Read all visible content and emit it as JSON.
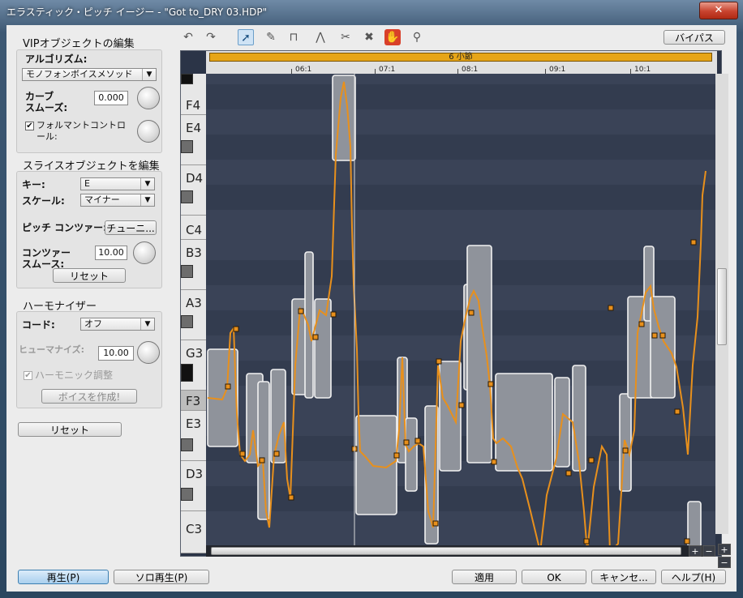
{
  "window": {
    "title": "エラスティック・ピッチ イージー - \"Got to_DRY 03.HDP\""
  },
  "vip": {
    "title": "VIPオブジェクトの編集",
    "algorithm_label": "アルゴリズム:",
    "algorithm_value": "モノフォンボイスメソッド",
    "curve_smooth_label": "カーブ\nスムーズ:",
    "curve_smooth_value": "0.000",
    "formant_label": "フォルマントコントロール:",
    "formant_checked": true
  },
  "slice": {
    "title": "スライスオブジェクトを編集",
    "key_label": "キー:",
    "key_value": "E",
    "scale_label": "スケール:",
    "scale_value": "マイナー",
    "contour_label": "ピッチ コンツァー:",
    "contour_value": "チューニ...",
    "contour_smooth_label": "コンツァー\nスムース:",
    "contour_smooth_value": "10.00",
    "reset_label": "リセット"
  },
  "harmonizer": {
    "title": "ハーモナイザー",
    "chord_label": "コード:",
    "chord_value": "オフ",
    "humanize_label": "ヒューマナイズ:",
    "humanize_value": "10.00",
    "harmonic_label": "ハーモニック調整",
    "harmonic_checked": true,
    "create_voice_label": "ボイスを作成!"
  },
  "left_reset_label": "リセット",
  "toolbar": {
    "bypass_label": "バイパス",
    "tools": [
      "undo-icon",
      "redo-icon",
      "pointer-icon",
      "pencil-icon",
      "gate-icon",
      "curve-icon",
      "scissors-icon",
      "erase-icon",
      "hand-icon",
      "zoom-icon"
    ],
    "selected_tool": "pointer-icon",
    "active_tool": "hand-icon"
  },
  "ruler": {
    "loop_label": "6 小節",
    "bars": [
      "06:1",
      "07:1",
      "08:1",
      "09:1",
      "10:1"
    ]
  },
  "keyboard": {
    "notes": [
      "F4",
      "E4",
      "D4",
      "C4",
      "B3",
      "A3",
      "G3",
      "F3",
      "E3",
      "D3",
      "C3"
    ]
  },
  "bottom": {
    "play_label": "再生(P)",
    "solo_play_label": "ソロ再生(P)",
    "apply_label": "適用",
    "ok_label": "OK",
    "cancel_label": "キャンセ...",
    "help_label": "ヘルプ(H)"
  },
  "colors": {
    "accent_orange": "#e8901c",
    "loop_gold": "#e6a518",
    "roll_bg": "#3a4357",
    "close_red": "#c8432e"
  }
}
